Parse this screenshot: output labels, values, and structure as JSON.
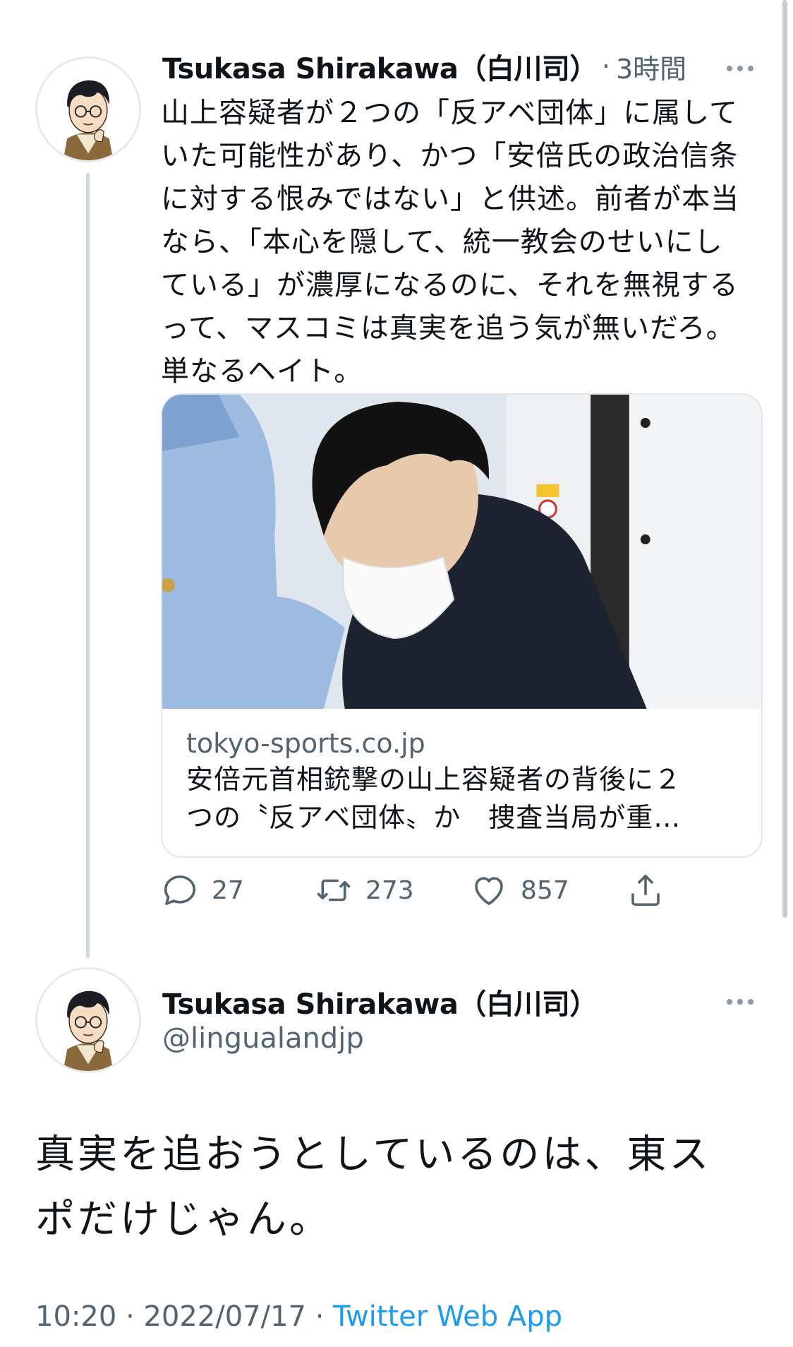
{
  "tweet1": {
    "display_name": "Tsukasa Shirakawa（白川司）",
    "time_separator": "·",
    "time": "3時間",
    "text": "山上容疑者が２つの「反アベ団体」に属して\nいた可能性があり、かつ「安倍氏の政治信条\nに対する恨みではない」と供述。前者が本当\nなら、「本心を隠して、統一教会のせいにし\nている」が濃厚になるのに、それを無視する\nって、マスコミは真実を追う気が無いだろ。\n単なるヘイト。",
    "card": {
      "domain": "tokyo-sports.co.jp",
      "title": "安倍元首相銃撃の山上容疑者の背後に２\nつの〝反アベ団体〟か　捜査当局が重…"
    },
    "actions": {
      "replies": "27",
      "retweets": "273",
      "likes": "857"
    }
  },
  "tweet2": {
    "display_name": "Tsukasa Shirakawa（白川司）",
    "handle": "@lingualandjp",
    "text": "真実を追おうとしているのは、東ス\nポだけじゃん。",
    "time": "10:20",
    "separator": "·",
    "date": "2022/07/17",
    "separator2": "·",
    "source": "Twitter Web App"
  },
  "colors": {
    "text": "#0f1419",
    "secondary": "#536471",
    "accent": "#1d9bf0",
    "border": "#e1e8ed"
  },
  "icons": [
    "more-icon",
    "reply-icon",
    "retweet-icon",
    "like-icon",
    "share-icon"
  ]
}
